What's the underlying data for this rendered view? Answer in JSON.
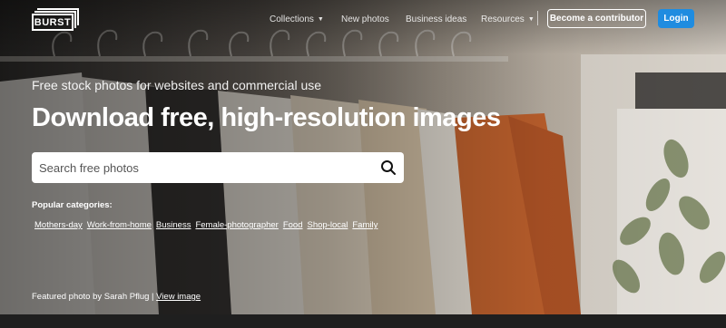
{
  "header": {
    "logo_text": "BURST",
    "nav": [
      {
        "label": "Collections",
        "has_dropdown": true
      },
      {
        "label": "New photos",
        "has_dropdown": false
      },
      {
        "label": "Business ideas",
        "has_dropdown": false
      },
      {
        "label": "Resources",
        "has_dropdown": true
      }
    ],
    "contributor_button": "Become a contributor",
    "login_button": "Login"
  },
  "hero": {
    "subtitle": "Free stock photos for websites and commercial use",
    "headline": "Download free, high-resolution images",
    "search": {
      "placeholder": "Search free photos",
      "value": "",
      "icon": "search-icon"
    },
    "popular_title": "Popular categories:",
    "categories": [
      "Mothers-day",
      "Work-from-home",
      "Business",
      "Female-photographer",
      "Food",
      "Shop-local",
      "Family"
    ],
    "featured_prefix": "Featured photo by Sarah Pflug |",
    "featured_link": "View image"
  },
  "colors": {
    "login_bg": "#1f8ce0",
    "text": "#ffffff"
  }
}
